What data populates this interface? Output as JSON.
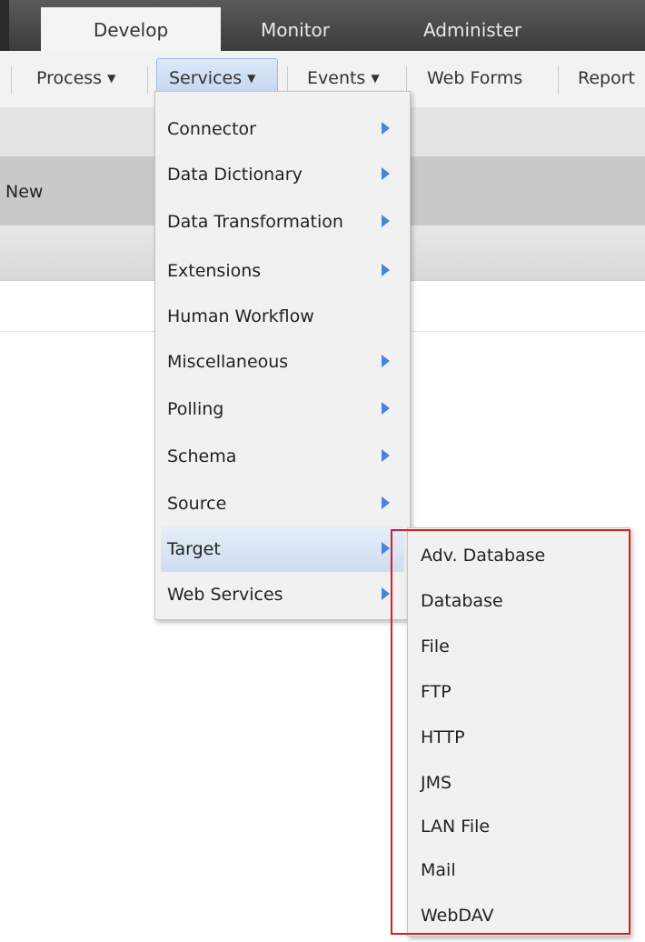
{
  "tabs": [
    {
      "label": "Develop",
      "active": true
    },
    {
      "label": "Monitor",
      "active": false
    },
    {
      "label": "Administer",
      "active": false
    }
  ],
  "menubar": {
    "process": "Process",
    "services": "Services",
    "events": "Events",
    "web_forms": "Web Forms",
    "reports": "Report",
    "caret": "▼"
  },
  "background": {
    "new_label": "New"
  },
  "dropdown": {
    "items": [
      {
        "label": "Connector",
        "has_submenu": true
      },
      {
        "label": "Data Dictionary",
        "has_submenu": true
      },
      {
        "label": "Data Transformation",
        "has_submenu": true
      },
      {
        "label": "Extensions",
        "has_submenu": true
      },
      {
        "label": "Human Workflow",
        "has_submenu": false
      },
      {
        "label": "Miscellaneous",
        "has_submenu": true
      },
      {
        "label": "Polling",
        "has_submenu": true
      },
      {
        "label": "Schema",
        "has_submenu": true
      },
      {
        "label": "Source",
        "has_submenu": true
      },
      {
        "label": "Target",
        "has_submenu": true,
        "highlighted": true
      },
      {
        "label": "Web Services",
        "has_submenu": true
      }
    ]
  },
  "submenu": {
    "items": [
      {
        "label": "Adv. Database"
      },
      {
        "label": "Database"
      },
      {
        "label": "File"
      },
      {
        "label": "FTP"
      },
      {
        "label": "HTTP"
      },
      {
        "label": "JMS"
      },
      {
        "label": "LAN File"
      },
      {
        "label": "Mail"
      },
      {
        "label": "WebDAV"
      }
    ]
  },
  "colors": {
    "highlight_box": "#d81e1e",
    "arrow": "#4a84d6",
    "active_tab": "#f4f4f4"
  }
}
